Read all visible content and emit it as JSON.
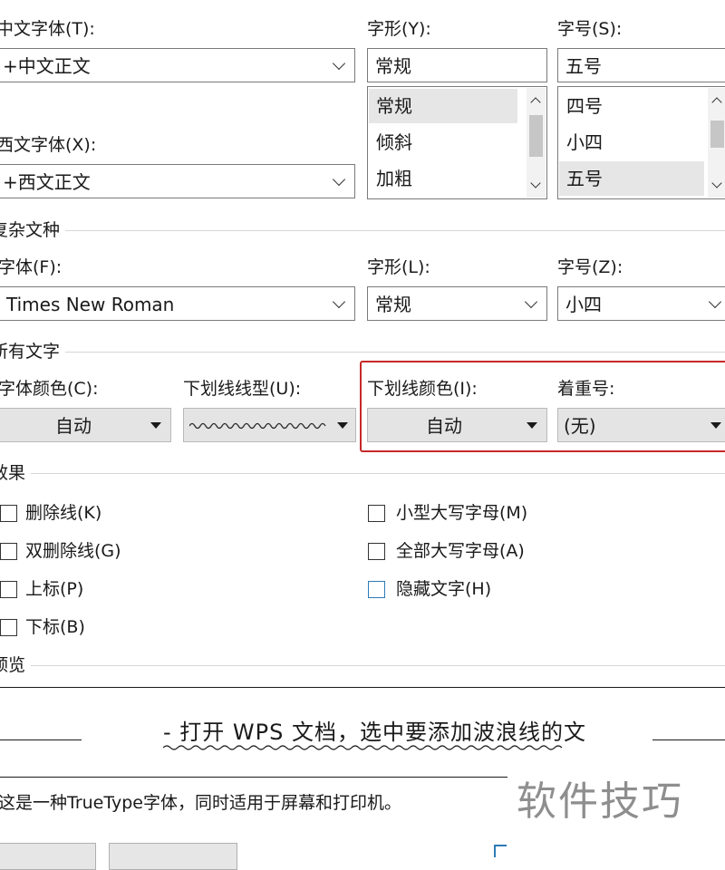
{
  "chinese_font": {
    "label": "中文字体(T):",
    "value": "+中文正文"
  },
  "style": {
    "label": "字形(Y):",
    "value": "常规",
    "options": [
      "常规",
      "倾斜",
      "加粗"
    ]
  },
  "size": {
    "label": "字号(S):",
    "value": "五号",
    "options": [
      "四号",
      "小四",
      "五号"
    ]
  },
  "western_font": {
    "label": "西文字体(X):",
    "value": "+西文正文"
  },
  "complex": {
    "group_label": "复杂文种",
    "font_label": "字体(F):",
    "font_value": "Times New Roman",
    "style_label": "字形(L):",
    "style_value": "常规",
    "size_label": "字号(Z):",
    "size_value": "小四"
  },
  "all_text": {
    "group_label": "所有文字",
    "font_color_label": "字体颜色(C):",
    "font_color_value": "自动",
    "underline_type_label": "下划线线型(U):",
    "underline_color_label": "下划线颜色(I):",
    "underline_color_value": "自动",
    "emphasis_label": "着重号:",
    "emphasis_value": "(无)"
  },
  "effects": {
    "group_label": "效果",
    "strikethrough": "删除线(K)",
    "double_strikethrough": "双删除线(G)",
    "superscript": "上标(P)",
    "subscript": "下标(B)",
    "small_caps": "小型大写字母(M)",
    "all_caps": "全部大写字母(A)",
    "hidden": "隐藏文字(H)"
  },
  "preview": {
    "group_label": "预览",
    "sample_text": "- 打开 WPS 文档，选中要添加波浪线的文",
    "note": "这是一种TrueType字体，同时适用于屏幕和打印机。"
  },
  "watermark": "软件技巧",
  "colors": {
    "highlight_border": "#c62828",
    "selected_item": "#e6e6e6",
    "button_face": "#e4e4e4"
  }
}
